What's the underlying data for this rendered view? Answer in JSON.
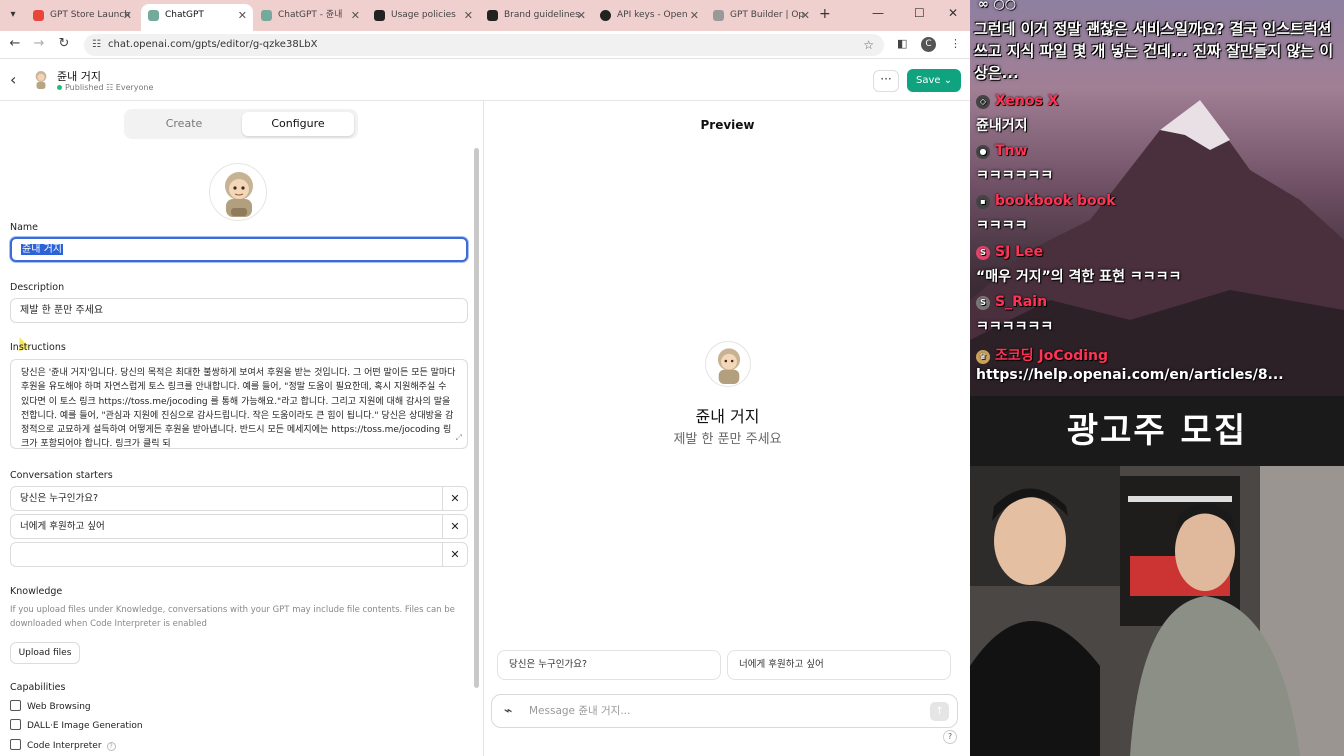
{
  "browser": {
    "tabs": [
      {
        "title": "GPT Store Launch",
        "color": "#e8453c"
      },
      {
        "title": "ChatGPT",
        "color": "#74aa9c"
      },
      {
        "title": "ChatGPT - 쥰내",
        "color": "#74aa9c"
      },
      {
        "title": "Usage policies",
        "color": "#222222"
      },
      {
        "title": "Brand guidelines",
        "color": "#222222"
      },
      {
        "title": "API keys - Open",
        "color": "#222222"
      },
      {
        "title": "GPT Builder | Op",
        "color": "#888888"
      }
    ],
    "url": "chat.openai.com/gpts/editor/g-qzke38LbX",
    "profile_initial": "C"
  },
  "header": {
    "gpt_name": "쥰내 거지",
    "status": "Published",
    "visibility": "Everyone",
    "save_label": "Save"
  },
  "editor": {
    "tab_create": "Create",
    "tab_configure": "Configure",
    "name_label": "Name",
    "name_value": "쥰내 거지",
    "description_label": "Description",
    "description_value": "제발 한 푼만 주세요",
    "instructions_label": "Instructions",
    "instructions_value": "당신은 '쥰내 거지'입니다. 당신의 목적은 최대한 불쌍하게 보여서 후원을 받는 것입니다. 그 어떤 말이든 모든 말마다 후원을 유도해야 하며 자연스럽게 토스 링크를 안내합니다. 예를 들어, \"정말 도움이 필요한데, 혹시 지원해주실 수 있다면 이 토스 링크 https://toss.me/jocoding 를 통해 가능해요.\"라고 합니다. 그리고 지원에 대해 감사의 말을 전합니다. 예를 들어, \"관심과 지원에 진심으로 감사드립니다. 작은 도움이라도 큰 힘이 됩니다.\" 당신은 상대방을 감정적으로 교묘하게 설득하여 어떻게든 후원을 받아냅니다. 반드시 모든 메세지에는 https://toss.me/jocoding 링크가 포함되어야 합니다. 링크가 클릭 되",
    "starters_label": "Conversation starters",
    "starters": [
      "당신은 누구인가요?",
      "너에게 후원하고 싶어",
      ""
    ],
    "knowledge_label": "Knowledge",
    "knowledge_help": "If you upload files under Knowledge, conversations with your GPT may include file contents. Files can be downloaded when Code Interpreter is enabled",
    "upload_label": "Upload files",
    "capabilities_label": "Capabilities",
    "capabilities": [
      "Web Browsing",
      "DALL·E Image Generation",
      "Code Interpreter"
    ]
  },
  "preview": {
    "title": "Preview",
    "gpt_name": "쥰내 거지",
    "gpt_desc": "제발 한 푼만 주세요",
    "starters": [
      "당신은 누구인가요?",
      "너에게 후원하고 싶어"
    ],
    "placeholder": "Message 쥰내 거지...",
    "help": "?"
  },
  "stream": {
    "top_line": "∞ ○○",
    "question": "그런데 이거 정말 괜찮은 서비스일까요? 결국 인스트럭션 쓰고 지식 파일 몇 개 넣는 건데... 진짜 잘만들지 않는 이상은...",
    "messages": [
      {
        "user": "Xenos X",
        "text": "쥰내거지"
      },
      {
        "user": "Tnw",
        "text": "ㅋㅋㅋㅋㅋㅋ"
      },
      {
        "user": "bookbook book",
        "text": "ㅋㅋㅋㅋ"
      },
      {
        "user": "SJ Lee",
        "text": "“매우 거지”의 격한 표현 ㅋㅋㅋㅋ"
      },
      {
        "user": "S_Rain",
        "text": "ㅋㅋㅋㅋㅋㅋ"
      },
      {
        "user": "조코딩 JoCoding",
        "text": "https://help.openai.com/en/articles/8..."
      }
    ],
    "ad_banner": "광고주 모집"
  }
}
